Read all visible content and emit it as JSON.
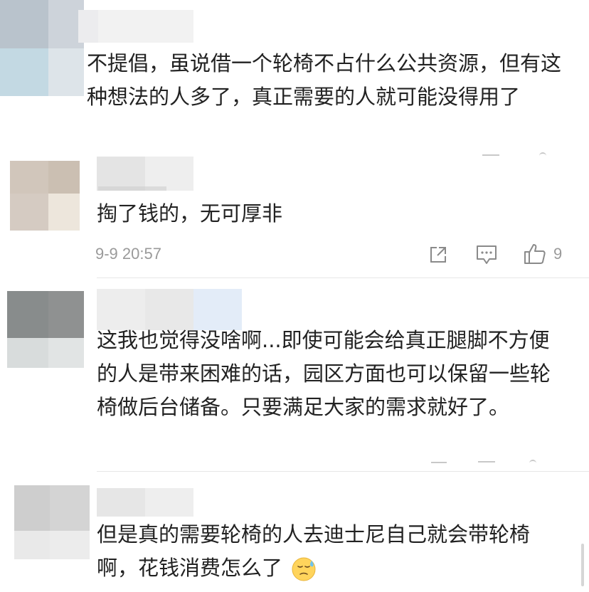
{
  "comments": [
    {
      "text": "不提倡，虽说借一个轮椅不占什么公共资源，但有这种想法的人多了，真正需要的人就可能没得用了"
    },
    {
      "text": "掏了钱的，无可厚非",
      "time": "9-9 20:57",
      "likes": "9"
    },
    {
      "text": "这我也觉得没啥啊...即使可能会给真正腿脚不方便的人是带来困难的话，园区方面也可以保留一些轮椅做后台储备。只要满足大家的需求就好了。"
    },
    {
      "text": "但是真的需要轮椅的人去迪士尼自己就会带轮椅啊，花钱消费怎么了"
    }
  ],
  "icons": {
    "share": "share-icon",
    "comment": "comment-icon",
    "like": "thumbs-up-icon",
    "emoji": "sweat-face-emoji"
  },
  "colors": {
    "text": "#222222",
    "meta": "#9a9a9a",
    "divider": "#e6e6e6",
    "icon": "#8a8a8a"
  }
}
